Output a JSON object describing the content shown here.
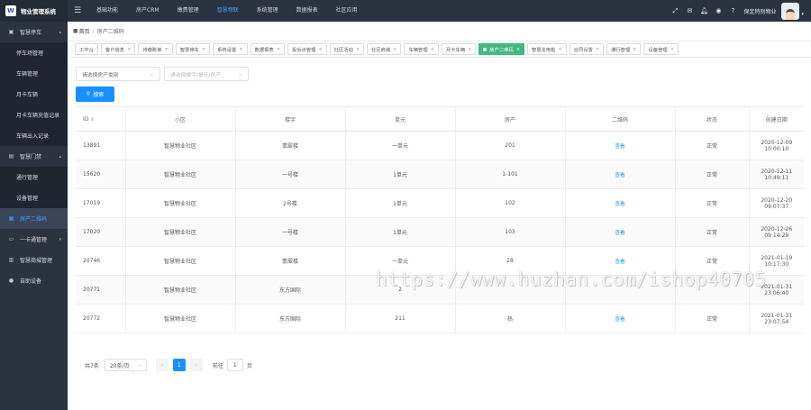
{
  "brand": {
    "name": "物业管理系统",
    "logo_glyph": "W"
  },
  "topnav": [
    "基础功能",
    "房产CRM",
    "缴费管理",
    "智慧物联",
    "系统管理",
    "数据报表",
    "社区应用"
  ],
  "topbar_right": {
    "username": "保定特别物业"
  },
  "sidebar": {
    "items": [
      {
        "label": "智慧停车",
        "icon": "car-icon",
        "level": 0,
        "arrow": "▴",
        "state": ""
      },
      {
        "label": "停车场管理",
        "icon": "",
        "level": 1,
        "state": ""
      },
      {
        "label": "车辆管理",
        "icon": "",
        "level": 1,
        "state": ""
      },
      {
        "label": "月卡车辆",
        "icon": "",
        "level": 1,
        "state": ""
      },
      {
        "label": "月卡车辆充值记录",
        "icon": "",
        "level": 1,
        "state": ""
      },
      {
        "label": "车辆出入记录",
        "icon": "",
        "level": 1,
        "state": ""
      },
      {
        "label": "智慧门禁",
        "icon": "lock-icon",
        "level": 0,
        "arrow": "▴",
        "state": ""
      },
      {
        "label": "通行管理",
        "icon": "",
        "level": 1,
        "state": ""
      },
      {
        "label": "设备管理",
        "icon": "",
        "level": 1,
        "state": ""
      },
      {
        "label": "房产二维码",
        "icon": "qrcode-icon",
        "level": 0,
        "arrow": "",
        "state": "active"
      },
      {
        "label": "一卡通管理",
        "icon": "card-icon",
        "level": 0,
        "arrow": "▾",
        "state": ""
      },
      {
        "label": "智慧商城管理",
        "icon": "shop-icon",
        "level": 0,
        "arrow": "",
        "state": ""
      },
      {
        "label": "自助设备",
        "icon": "device-icon",
        "level": 0,
        "arrow": "",
        "state": ""
      }
    ]
  },
  "breadcrumb": {
    "home": "首页",
    "current": "房产二维码"
  },
  "tabs": [
    {
      "label": "工作台",
      "active": false,
      "closable": false
    },
    {
      "label": "客户信息",
      "active": false,
      "closable": true
    },
    {
      "label": "待缴账单",
      "active": false,
      "closable": true
    },
    {
      "label": "智慧停车",
      "active": false,
      "closable": true
    },
    {
      "label": "系统设置",
      "active": false,
      "closable": true
    },
    {
      "label": "数据报表",
      "active": false,
      "closable": true
    },
    {
      "label": "投诉点管理",
      "active": false,
      "closable": true
    },
    {
      "label": "社区活动",
      "active": false,
      "closable": true
    },
    {
      "label": "社区商城",
      "active": false,
      "closable": true
    },
    {
      "label": "车辆管理",
      "active": false,
      "closable": true
    },
    {
      "label": "月卡车辆",
      "active": false,
      "closable": true
    },
    {
      "label": "房产二维码",
      "active": true,
      "closable": true
    },
    {
      "label": "智慧充电桩",
      "active": false,
      "closable": true
    },
    {
      "label": "合同设置",
      "active": false,
      "closable": true
    },
    {
      "label": "通行管理",
      "active": false,
      "closable": true
    },
    {
      "label": "设备管理",
      "active": false,
      "closable": true
    }
  ],
  "filters": {
    "select1_placeholder": "请选择房产类别",
    "select2_placeholder": "请选择楼宇/单元/房产",
    "search_label": "搜索"
  },
  "table": {
    "headers": [
      "ID",
      "小区",
      "楼宇",
      "单元",
      "房产",
      "二维码",
      "状态",
      "创建日期"
    ],
    "rows": [
      {
        "id": "13891",
        "community": "智慧物业社区",
        "building": "翡翠楼",
        "unit": "一单元",
        "room": "201",
        "qrcode": "查看",
        "status": "正常",
        "date1": "2020-12-09",
        "date2": "10:00:10"
      },
      {
        "id": "15620",
        "community": "智慧物业社区",
        "building": "一号楼",
        "unit": "1单元",
        "room": "1-101",
        "qrcode": "查看",
        "status": "正常",
        "date1": "2020-12-11",
        "date2": "10:49:11"
      },
      {
        "id": "17019",
        "community": "智慧物业社区",
        "building": "2号楼",
        "unit": "1单元",
        "room": "102",
        "qrcode": "查看",
        "status": "正常",
        "date1": "2020-12-20",
        "date2": "09:07:37"
      },
      {
        "id": "17020",
        "community": "智慧物业社区",
        "building": "一号楼",
        "unit": "1单元",
        "room": "103",
        "qrcode": "查看",
        "status": "正常",
        "date1": "2020-12-26",
        "date2": "09:14:29"
      },
      {
        "id": "20746",
        "community": "智慧物业社区",
        "building": "翡翠楼",
        "unit": "一单元",
        "room": "28",
        "qrcode": "查看",
        "status": "正常",
        "date1": "2021-01-19",
        "date2": "10:17:30"
      },
      {
        "id": "20771",
        "community": "智慧物业社区",
        "building": "东方国际",
        "unit": "2",
        "room": "",
        "qrcode": "",
        "status": "",
        "date1": "2021-01-31",
        "date2": "23:06:40"
      },
      {
        "id": "20772",
        "community": "智慧物业社区",
        "building": "东方国际",
        "unit": "211",
        "room": "热",
        "qrcode": "查看",
        "status": "正常",
        "date1": "2021-01-31",
        "date2": "23:07:54"
      }
    ]
  },
  "pagination": {
    "total_text": "共7条",
    "page_size": "20条/页",
    "prev": "‹",
    "current_page": "1",
    "next": "›",
    "goto_label": "前往",
    "goto_value": "1",
    "page_unit": "页"
  },
  "watermark": "https://www.huzhan.com/ishop40705",
  "colors": {
    "topbar": "#2b3340",
    "accent": "#1890ff",
    "active_tab": "#42b983"
  }
}
